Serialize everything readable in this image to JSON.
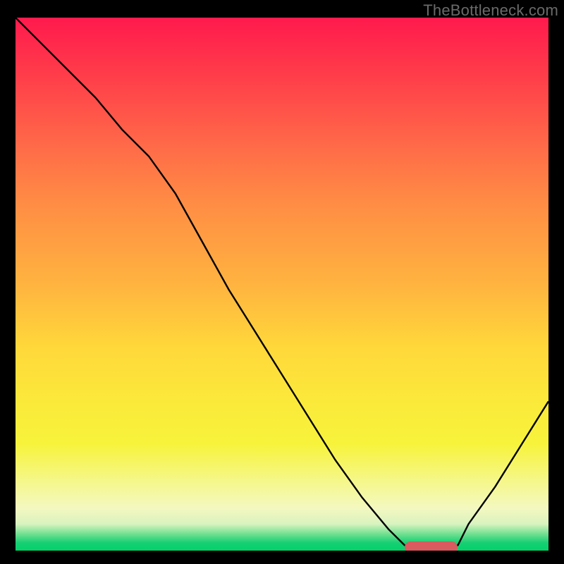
{
  "watermark": "TheBottleneck.com",
  "chart_data": {
    "type": "line",
    "title": "",
    "xlabel": "",
    "ylabel": "",
    "xlim": [
      0,
      100
    ],
    "ylim": [
      0,
      100
    ],
    "grid": false,
    "series": [
      {
        "name": "bottleneck-curve",
        "x": [
          0,
          5,
          10,
          15,
          20,
          25,
          30,
          35,
          40,
          45,
          50,
          55,
          60,
          65,
          70,
          73,
          75,
          78,
          80,
          83,
          85,
          90,
          95,
          100
        ],
        "values": [
          100,
          95,
          90,
          85,
          79,
          74,
          67,
          58,
          49,
          41,
          33,
          25,
          17,
          10,
          4,
          1,
          0.5,
          0.5,
          0.5,
          1,
          5,
          12,
          20,
          28
        ]
      }
    ],
    "marker": {
      "x_start": 73,
      "x_end": 83,
      "y": 0.5,
      "label": "optimal-range",
      "color": "#d95a5f"
    },
    "gradient_bands": [
      {
        "stop": 0,
        "color": "#ff1a4d"
      },
      {
        "stop": 35,
        "color": "#ff8d44"
      },
      {
        "stop": 72,
        "color": "#fbe93a"
      },
      {
        "stop": 95,
        "color": "#d9f3bf"
      },
      {
        "stop": 100,
        "color": "#00d26a"
      }
    ]
  }
}
